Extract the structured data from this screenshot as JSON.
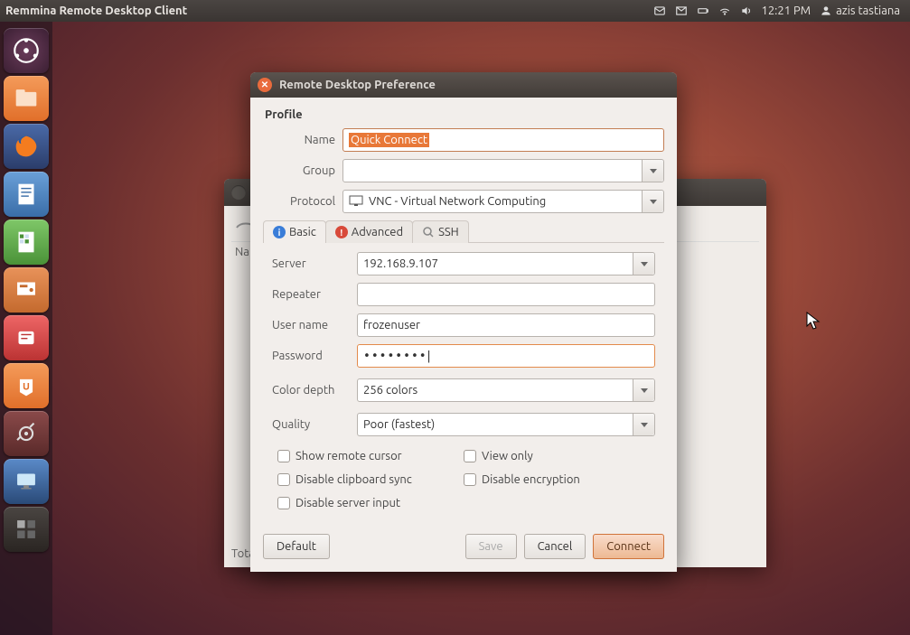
{
  "menubar": {
    "title": "Remmina Remote Desktop Client",
    "time": "12:21 PM",
    "user": "azis tastiana"
  },
  "bgwindow": {
    "col1": "Nar",
    "footer": "Tota"
  },
  "dialog": {
    "title": "Remote Desktop Preference",
    "profile_label": "Profile",
    "name_label": "Name",
    "name_value": "Quick Connect",
    "group_label": "Group",
    "group_value": "",
    "protocol_label": "Protocol",
    "protocol_value": "VNC - Virtual Network Computing",
    "tabs": {
      "basic": "Basic",
      "advanced": "Advanced",
      "ssh": "SSH"
    },
    "server_label": "Server",
    "server_value": "192.168.9.107",
    "repeater_label": "Repeater",
    "repeater_value": "",
    "username_label": "User name",
    "username_value": "frozenuser",
    "password_label": "Password",
    "password_value": "••••••••",
    "colordepth_label": "Color depth",
    "colordepth_value": "256 colors",
    "quality_label": "Quality",
    "quality_value": "Poor (fastest)",
    "checks": {
      "show_remote_cursor": "Show remote cursor",
      "view_only": "View only",
      "disable_clipboard": "Disable clipboard sync",
      "disable_encryption": "Disable encryption",
      "disable_server_input": "Disable server input"
    },
    "buttons": {
      "default": "Default",
      "save": "Save",
      "cancel": "Cancel",
      "connect": "Connect"
    }
  },
  "launcher_icons": [
    "dash",
    "files",
    "firefox",
    "writer",
    "calc",
    "impress",
    "media",
    "software-center",
    "settings",
    "remmina",
    "workspace"
  ]
}
